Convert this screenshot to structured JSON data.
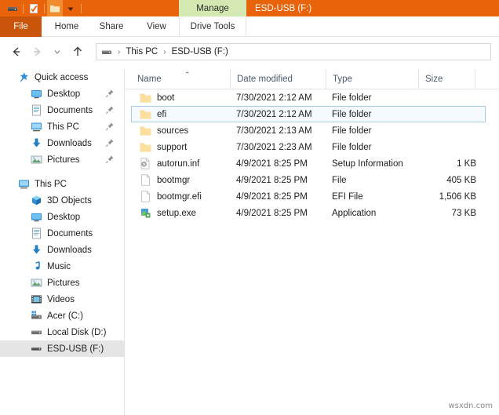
{
  "window": {
    "title": "ESD-USB (F:)",
    "contextual_tab_group": "Manage",
    "quick_access_toolbar": [
      {
        "icon": "drive-icon",
        "name": "drive-properties"
      },
      {
        "icon": "checkmark-properties-icon",
        "name": "properties"
      },
      {
        "icon": "new-folder-icon",
        "name": "new-folder"
      },
      {
        "icon": "chevron-down-icon",
        "name": "customize-quick-access"
      }
    ]
  },
  "ribbon": {
    "tabs": [
      {
        "label": "File",
        "id": "file"
      },
      {
        "label": "Home",
        "id": "home"
      },
      {
        "label": "Share",
        "id": "share"
      },
      {
        "label": "View",
        "id": "view"
      },
      {
        "label": "Drive Tools",
        "id": "drive-tools"
      }
    ]
  },
  "address": {
    "back_icon": "arrow-left-icon",
    "forward_icon": "arrow-right-icon",
    "recent_icon": "chevron-down-icon",
    "up_icon": "arrow-up-icon",
    "breadcrumb": [
      {
        "label": "This PC"
      },
      {
        "label": "ESD-USB (F:)"
      }
    ],
    "separator": "›"
  },
  "sidebar": {
    "groups": [
      {
        "header": {
          "label": "Quick access",
          "icon": "star-pin-icon"
        },
        "items": [
          {
            "label": "Desktop",
            "icon": "desktop-icon",
            "pinned": true
          },
          {
            "label": "Documents",
            "icon": "documents-icon",
            "pinned": true
          },
          {
            "label": "This PC",
            "icon": "this-pc-icon",
            "pinned": true
          },
          {
            "label": "Downloads",
            "icon": "downloads-icon",
            "pinned": true
          },
          {
            "label": "Pictures",
            "icon": "pictures-icon",
            "pinned": true
          }
        ]
      },
      {
        "header": {
          "label": "This PC",
          "icon": "this-pc-icon"
        },
        "items": [
          {
            "label": "3D Objects",
            "icon": "3d-objects-icon",
            "pinned": false
          },
          {
            "label": "Desktop",
            "icon": "desktop-icon",
            "pinned": false
          },
          {
            "label": "Documents",
            "icon": "documents-icon",
            "pinned": false
          },
          {
            "label": "Downloads",
            "icon": "downloads-icon",
            "pinned": false
          },
          {
            "label": "Music",
            "icon": "music-icon",
            "pinned": false
          },
          {
            "label": "Pictures",
            "icon": "pictures-icon",
            "pinned": false
          },
          {
            "label": "Videos",
            "icon": "videos-icon",
            "pinned": false
          },
          {
            "label": "Acer (C:)",
            "icon": "windows-drive-icon",
            "pinned": false
          },
          {
            "label": "Local Disk (D:)",
            "icon": "hard-drive-icon",
            "pinned": false
          },
          {
            "label": "ESD-USB (F:)",
            "icon": "usb-drive-icon",
            "pinned": false,
            "selected": true
          }
        ]
      }
    ]
  },
  "filelist": {
    "columns": [
      {
        "label": "Name",
        "sorted": "asc"
      },
      {
        "label": "Date modified"
      },
      {
        "label": "Type"
      },
      {
        "label": "Size"
      }
    ],
    "sort_caret": "⌃",
    "rows": [
      {
        "name": "boot",
        "date": "7/30/2021 2:12 AM",
        "type": "File folder",
        "size": "",
        "icon": "folder-icon",
        "selected": false
      },
      {
        "name": "efi",
        "date": "7/30/2021 2:12 AM",
        "type": "File folder",
        "size": "",
        "icon": "folder-icon",
        "selected": true
      },
      {
        "name": "sources",
        "date": "7/30/2021 2:13 AM",
        "type": "File folder",
        "size": "",
        "icon": "folder-icon",
        "selected": false
      },
      {
        "name": "support",
        "date": "7/30/2021 2:23 AM",
        "type": "File folder",
        "size": "",
        "icon": "folder-icon",
        "selected": false
      },
      {
        "name": "autorun.inf",
        "date": "4/9/2021 8:25 PM",
        "type": "Setup Information",
        "size": "1 KB",
        "icon": "setup-info-icon",
        "selected": false
      },
      {
        "name": "bootmgr",
        "date": "4/9/2021 8:25 PM",
        "type": "File",
        "size": "405 KB",
        "icon": "generic-file-icon",
        "selected": false
      },
      {
        "name": "bootmgr.efi",
        "date": "4/9/2021 8:25 PM",
        "type": "EFI File",
        "size": "1,506 KB",
        "icon": "generic-file-icon",
        "selected": false
      },
      {
        "name": "setup.exe",
        "date": "4/9/2021 8:25 PM",
        "type": "Application",
        "size": "73 KB",
        "icon": "application-icon",
        "selected": false
      }
    ]
  },
  "watermark": {
    "text": "wsxdn.com"
  },
  "colors": {
    "titlebar_orange": "#e8630a",
    "file_tab_orange": "#c8550a",
    "contextual_green": "#d4e9b2",
    "selection_border": "#aacbe0",
    "selection_fill": "#f4fafd",
    "sidebar_selection": "#e5e5e5",
    "folder_yellow": "#fcdf9c"
  }
}
